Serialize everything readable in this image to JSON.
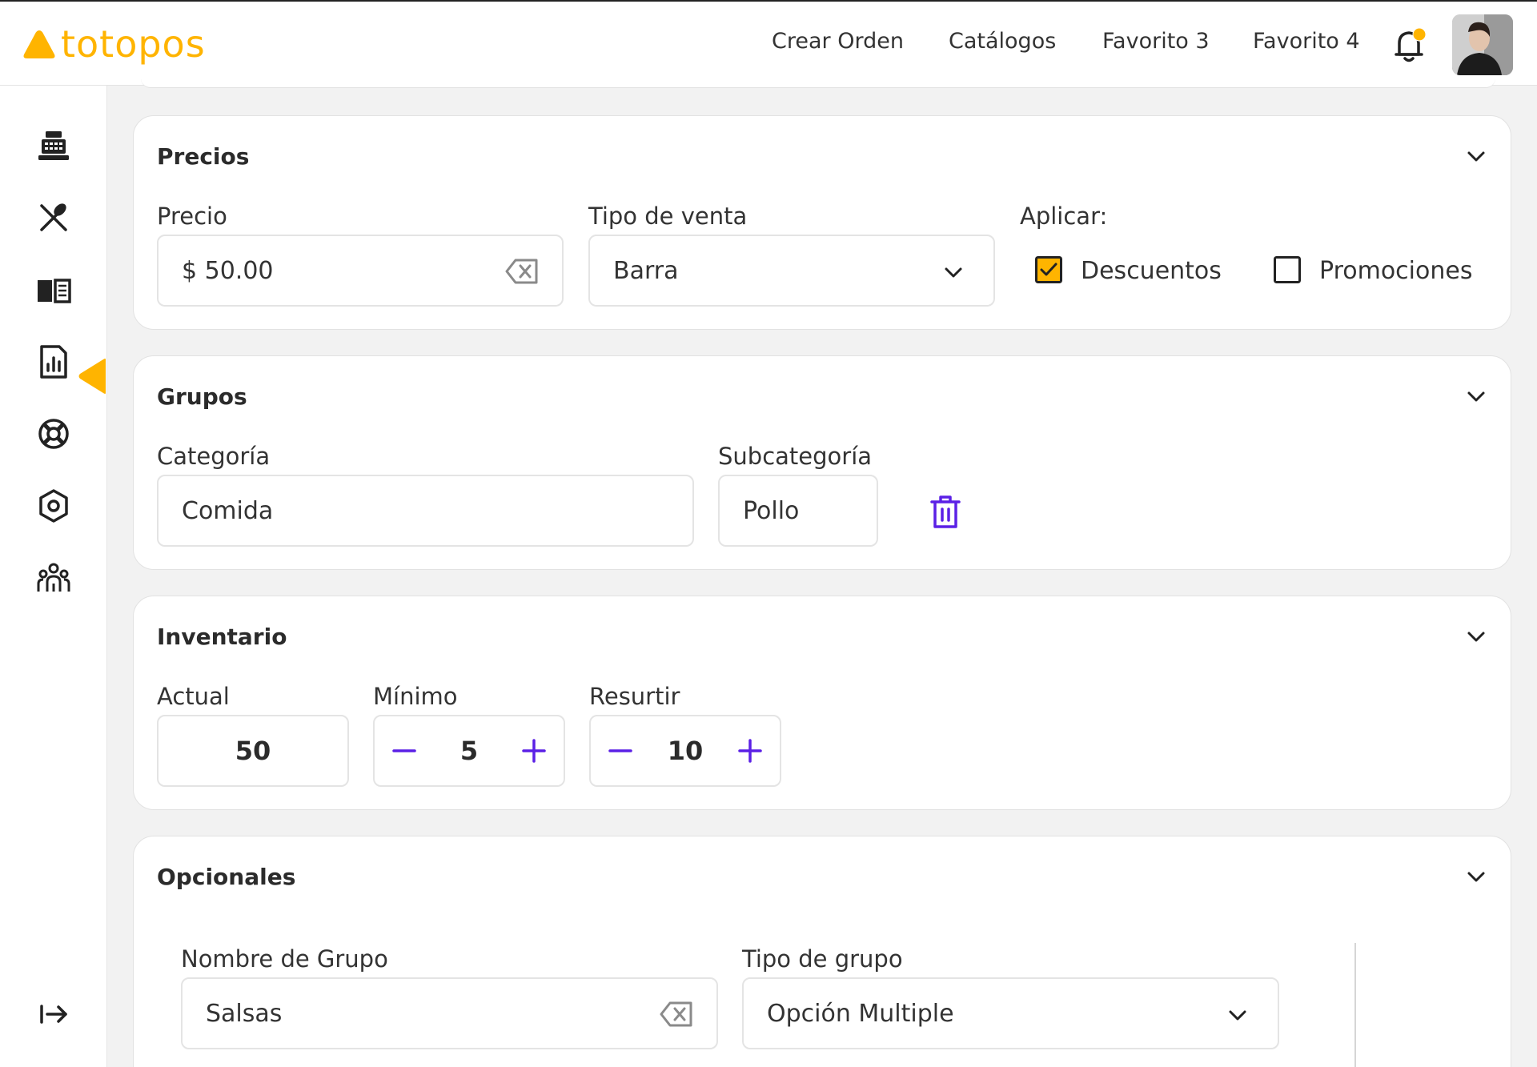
{
  "brand": {
    "name": "totopos",
    "color": "#ffb400"
  },
  "header": {
    "nav": [
      "Crear Orden",
      "Catálogos",
      "Favorito 3",
      "Favorito 4"
    ],
    "icons": [
      "bell-icon",
      "user-avatar"
    ]
  },
  "sidebar": {
    "items": [
      "cash-register-icon",
      "utensils-icon",
      "menu-book-icon",
      "report-icon",
      "support-icon",
      "settings-icon",
      "users-icon"
    ],
    "active": "menu-book-icon",
    "logout": "logout-icon"
  },
  "precios": {
    "title": "Precios",
    "precio_label": "Precio",
    "precio_value": "$ 50.00",
    "tipo_venta_label": "Tipo de venta",
    "tipo_venta_value": "Barra",
    "aplicar_label": "Aplicar:",
    "descuentos_label": "Descuentos",
    "descuentos_checked": true,
    "promociones_label": "Promociones",
    "promociones_checked": false
  },
  "grupos": {
    "title": "Grupos",
    "categoria_label": "Categoría",
    "categoria_value": "Comida",
    "subcategoria_label": "Subcategoría",
    "subcategoria_value": "Pollo"
  },
  "inventario": {
    "title": "Inventario",
    "actual_label": "Actual",
    "actual_value": "50",
    "minimo_label": "Mínimo",
    "minimo_value": "5",
    "resurtir_label": "Resurtir",
    "resurtir_value": "10"
  },
  "opcionales": {
    "title": "Opcionales",
    "nombre_label": "Nombre de Grupo",
    "nombre_value": "Salsas",
    "tipo_label": "Tipo de grupo",
    "tipo_value": "Opción Multiple"
  },
  "colors": {
    "accent": "#ffb400",
    "action": "#5b20e6",
    "border": "#e4e4e4"
  }
}
